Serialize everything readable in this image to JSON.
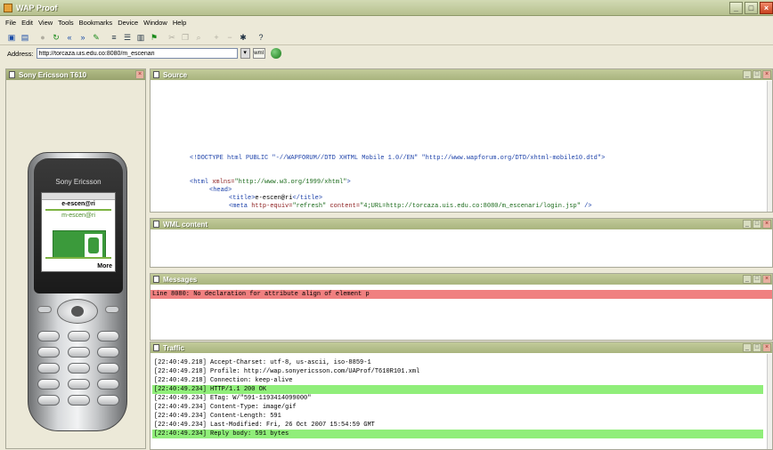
{
  "window": {
    "title": "WAP Proof",
    "minimize_label": "_",
    "maximize_label": "□",
    "close_label": "×"
  },
  "menu": [
    "File",
    "Edit",
    "View",
    "Tools",
    "Bookmarks",
    "Device",
    "Window",
    "Help"
  ],
  "toolbar": {
    "buttons": [
      {
        "name": "open-icon",
        "glyph": "▣"
      },
      {
        "name": "save-icon",
        "glyph": "▤"
      },
      {
        "name": "stop-icon",
        "glyph": "●"
      },
      {
        "name": "reload-icon",
        "glyph": "↻"
      },
      {
        "name": "back-icon",
        "glyph": "«"
      },
      {
        "name": "forward-icon",
        "glyph": "»"
      },
      {
        "name": "edit-icon",
        "glyph": "✎"
      },
      {
        "name": "list-icon",
        "glyph": "≡"
      },
      {
        "name": "detail-icon",
        "glyph": "☰"
      },
      {
        "name": "source-icon",
        "glyph": "▥"
      },
      {
        "name": "run-icon",
        "glyph": "⚑"
      },
      {
        "name": "cut-icon",
        "glyph": "✂"
      },
      {
        "name": "copy-icon",
        "glyph": "❐"
      },
      {
        "name": "find-icon",
        "glyph": "⌕"
      },
      {
        "name": "zoom-in-icon",
        "glyph": "+"
      },
      {
        "name": "zoom-out-icon",
        "glyph": "−"
      },
      {
        "name": "bug-icon",
        "glyph": "✱"
      },
      {
        "name": "help-icon",
        "glyph": "?"
      }
    ]
  },
  "address": {
    "label": "Address:",
    "value": "http://torcaza.uis.edu.co:8080/m_escenari",
    "dropdown_glyph": "▾",
    "wml_button": "wml"
  },
  "device_panel": {
    "title": "Sony Ericsson T610",
    "phone": {
      "brand": "Sony Ericsson",
      "screen_title": "e-escen@ri",
      "screen_logo": "m-escen@ri",
      "softkey": "More"
    }
  },
  "source_panel": {
    "title": "Source",
    "lines": [
      {
        "indent": 0,
        "parts": [
          {
            "c": "tag",
            "t": "<!DOCTYPE html PUBLIC \"-//WAPFORUM//DTD XHTML Mobile 1.0//EN\" \"http://www.wapforum.org/DTD/xhtml-mobile10.dtd\">"
          }
        ]
      },
      {
        "indent": 0,
        "parts": []
      },
      {
        "indent": 0,
        "parts": [
          {
            "c": "tag",
            "t": "<html "
          },
          {
            "c": "att",
            "t": "xmlns="
          },
          {
            "c": "val",
            "t": "\"http://www.w3.org/1999/xhtml\""
          },
          {
            "c": "tag",
            "t": ">"
          }
        ]
      },
      {
        "indent": 1,
        "parts": [
          {
            "c": "tag",
            "t": "<head>"
          }
        ]
      },
      {
        "indent": 2,
        "parts": [
          {
            "c": "tag",
            "t": "<title>"
          },
          {
            "c": "txt",
            "t": "e-escen@ri"
          },
          {
            "c": "tag",
            "t": "</title>"
          }
        ]
      },
      {
        "indent": 2,
        "parts": [
          {
            "c": "tag",
            "t": "<meta "
          },
          {
            "c": "att",
            "t": "http-equiv="
          },
          {
            "c": "val",
            "t": "\"refresh\" "
          },
          {
            "c": "att",
            "t": "content="
          },
          {
            "c": "val",
            "t": "\"4;URL=http://torcaza.uis.edu.co:8080/m_escenari/login.jsp\""
          },
          {
            "c": "tag",
            "t": " />"
          }
        ]
      }
    ]
  },
  "wml_panel": {
    "title": "WML content"
  },
  "messages_panel": {
    "title": "Messages",
    "message": "Line 8080: No declaration for attribute align of element p"
  },
  "traffic_panel": {
    "title": "Traffic",
    "rows": [
      {
        "text": "[22:40:49.218] Accept-Charset: utf-8, us-ascii, iso-8859-1",
        "highlight": false
      },
      {
        "text": "[22:40:49.218] Profile: http://wap.sonyericsson.com/UAProf/T610R101.xml",
        "highlight": false
      },
      {
        "text": "[22:40:49.218] Connection: keep-alive",
        "highlight": false
      },
      {
        "text": "[22:40:49.234] HTTP/1.1 200 OK",
        "highlight": true
      },
      {
        "text": "[22:40:49.234] ETag: W/\"591-1193414099000\"",
        "highlight": false
      },
      {
        "text": "[22:40:49.234] Content-Type: image/gif",
        "highlight": false
      },
      {
        "text": "[22:40:49.234] Content-Length: 591",
        "highlight": false
      },
      {
        "text": "[22:40:49.234] Last-Modified: Fri, 26 Oct 2007 15:54:59 GMT",
        "highlight": false
      },
      {
        "text": "[22:40:49.234] Reply body: 591 bytes",
        "highlight": true
      }
    ]
  }
}
